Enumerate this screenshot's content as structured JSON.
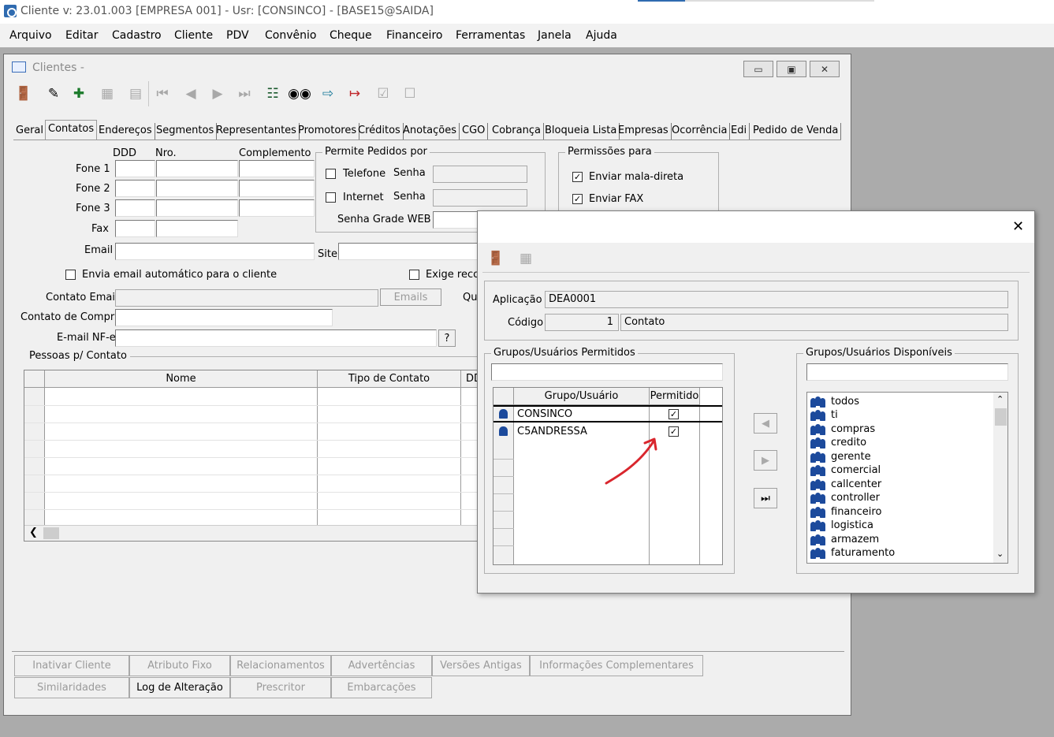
{
  "titlebar": {
    "title": "Cliente  v: 23.01.003   [EMPRESA 001] - Usr: [CONSINCO] - [BASE15@SAIDA]"
  },
  "menu": [
    "Arquivo",
    "Editar",
    "Cadastro",
    "Cliente",
    "PDV",
    "Convênio",
    "Cheque",
    "Financeiro",
    "Ferramentas",
    "Janela",
    "Ajuda"
  ],
  "clientes": {
    "title": "Clientes -",
    "tabs": [
      "Geral",
      "Contatos",
      "Endereços",
      "Segmentos",
      "Representantes",
      "Promotores",
      "Créditos",
      "Anotações",
      "CGO",
      "Cobrança",
      "Bloqueia Lista",
      "Empresas",
      "Ocorrência",
      "Edi",
      "Pedido de Venda"
    ],
    "phone_headers": {
      "ddd": "DDD",
      "nro": "Nro.",
      "complemento": "Complemento"
    },
    "labels": {
      "fone1": "Fone 1",
      "fone2": "Fone 2",
      "fone3": "Fone 3",
      "fax": "Fax",
      "email": "Email",
      "site": "Site",
      "envia_email": "Envia email automático para o cliente",
      "exige": "Exige recor",
      "contato_email": "Contato Email",
      "emails_btn": "Emails",
      "qu": "Qu",
      "contato_compra": "Contato de Compra",
      "email_nfe": "E-mail NF-e",
      "help_btn": "?",
      "pessoas": "Pessoas p/ Contato"
    },
    "permite_pedidos": {
      "title": "Permite Pedidos por",
      "telefone": "Telefone",
      "internet": "Internet",
      "senha": "Senha",
      "senha_grade": "Senha Grade WEB"
    },
    "permissoes": {
      "title": "Permissões para",
      "mala_direta": "Enviar mala-direta",
      "fax": "Enviar FAX"
    },
    "grid_headers": [
      "Nome",
      "Tipo de Contato",
      "DD"
    ],
    "bottom_row1": [
      "Inativar Cliente",
      "Atributo Fixo",
      "Relacionamentos",
      "Advertências",
      "Versões Antigas",
      "Informações Complementares"
    ],
    "bottom_row2": [
      "Similaridades",
      "Log de Alteração",
      "Prescritor",
      "Embarcações"
    ]
  },
  "dialog": {
    "aplicacao_label": "Aplicação",
    "aplicacao_value": "DEA0001",
    "codigo_label": "Código",
    "codigo_value": "1",
    "codigo_desc": "Contato",
    "permitidos_title": "Grupos/Usuários Permitidos",
    "disponiveis_title": "Grupos/Usuários Disponíveis",
    "col_grupo": "Grupo/Usuário",
    "col_permitido": "Permitido",
    "permitidos": [
      "CONSINCO",
      "C5ANDRESSA"
    ],
    "disponiveis": [
      "todos",
      "ti",
      "compras",
      "credito",
      "gerente",
      "comercial",
      "callcenter",
      "controller",
      "financeiro",
      "logistica",
      "armazem",
      "faturamento"
    ]
  },
  "colors": {
    "accent_blue": "#1c4a9c",
    "annotation_red": "#d9262d"
  }
}
